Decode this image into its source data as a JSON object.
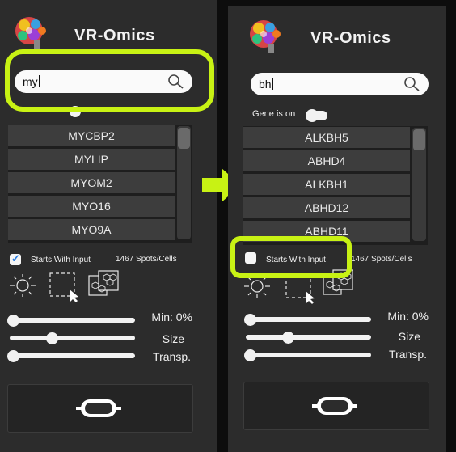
{
  "app": {
    "title": "VR-Omics"
  },
  "left": {
    "search_value": "my",
    "list_items": [
      "MYCBP2",
      "MYLIP",
      "MYOM2",
      "MYO16",
      "MYO9A"
    ],
    "starts_with_label": "Starts With Input",
    "starts_with_checked": true,
    "spots_count": "1467 Spots/Cells",
    "min_label": "Min: 0%",
    "size_label": "Size",
    "transp_label": "Transp."
  },
  "right": {
    "search_value": "bh",
    "gene_is_on_label": "Gene is on",
    "list_items": [
      "ALKBH5",
      "ABHD4",
      "ALKBH1",
      "ABHD12",
      "ABHD11"
    ],
    "starts_with_label": "Starts With Input",
    "starts_with_checked": false,
    "spots_count": "1467 Spots/Cells",
    "min_label": "Min: 0%",
    "size_label": "Size",
    "transp_label": "Transp."
  },
  "colors": {
    "highlight": "#c8f214",
    "panel": "#2c2c2c",
    "list_item": "#3d3d3d"
  },
  "icons": [
    "brain-logo-icon",
    "search-icon",
    "sun-icon",
    "lasso-select-icon",
    "hexagon-grid-icon",
    "vr-headset-icon",
    "right-arrow-icon"
  ]
}
